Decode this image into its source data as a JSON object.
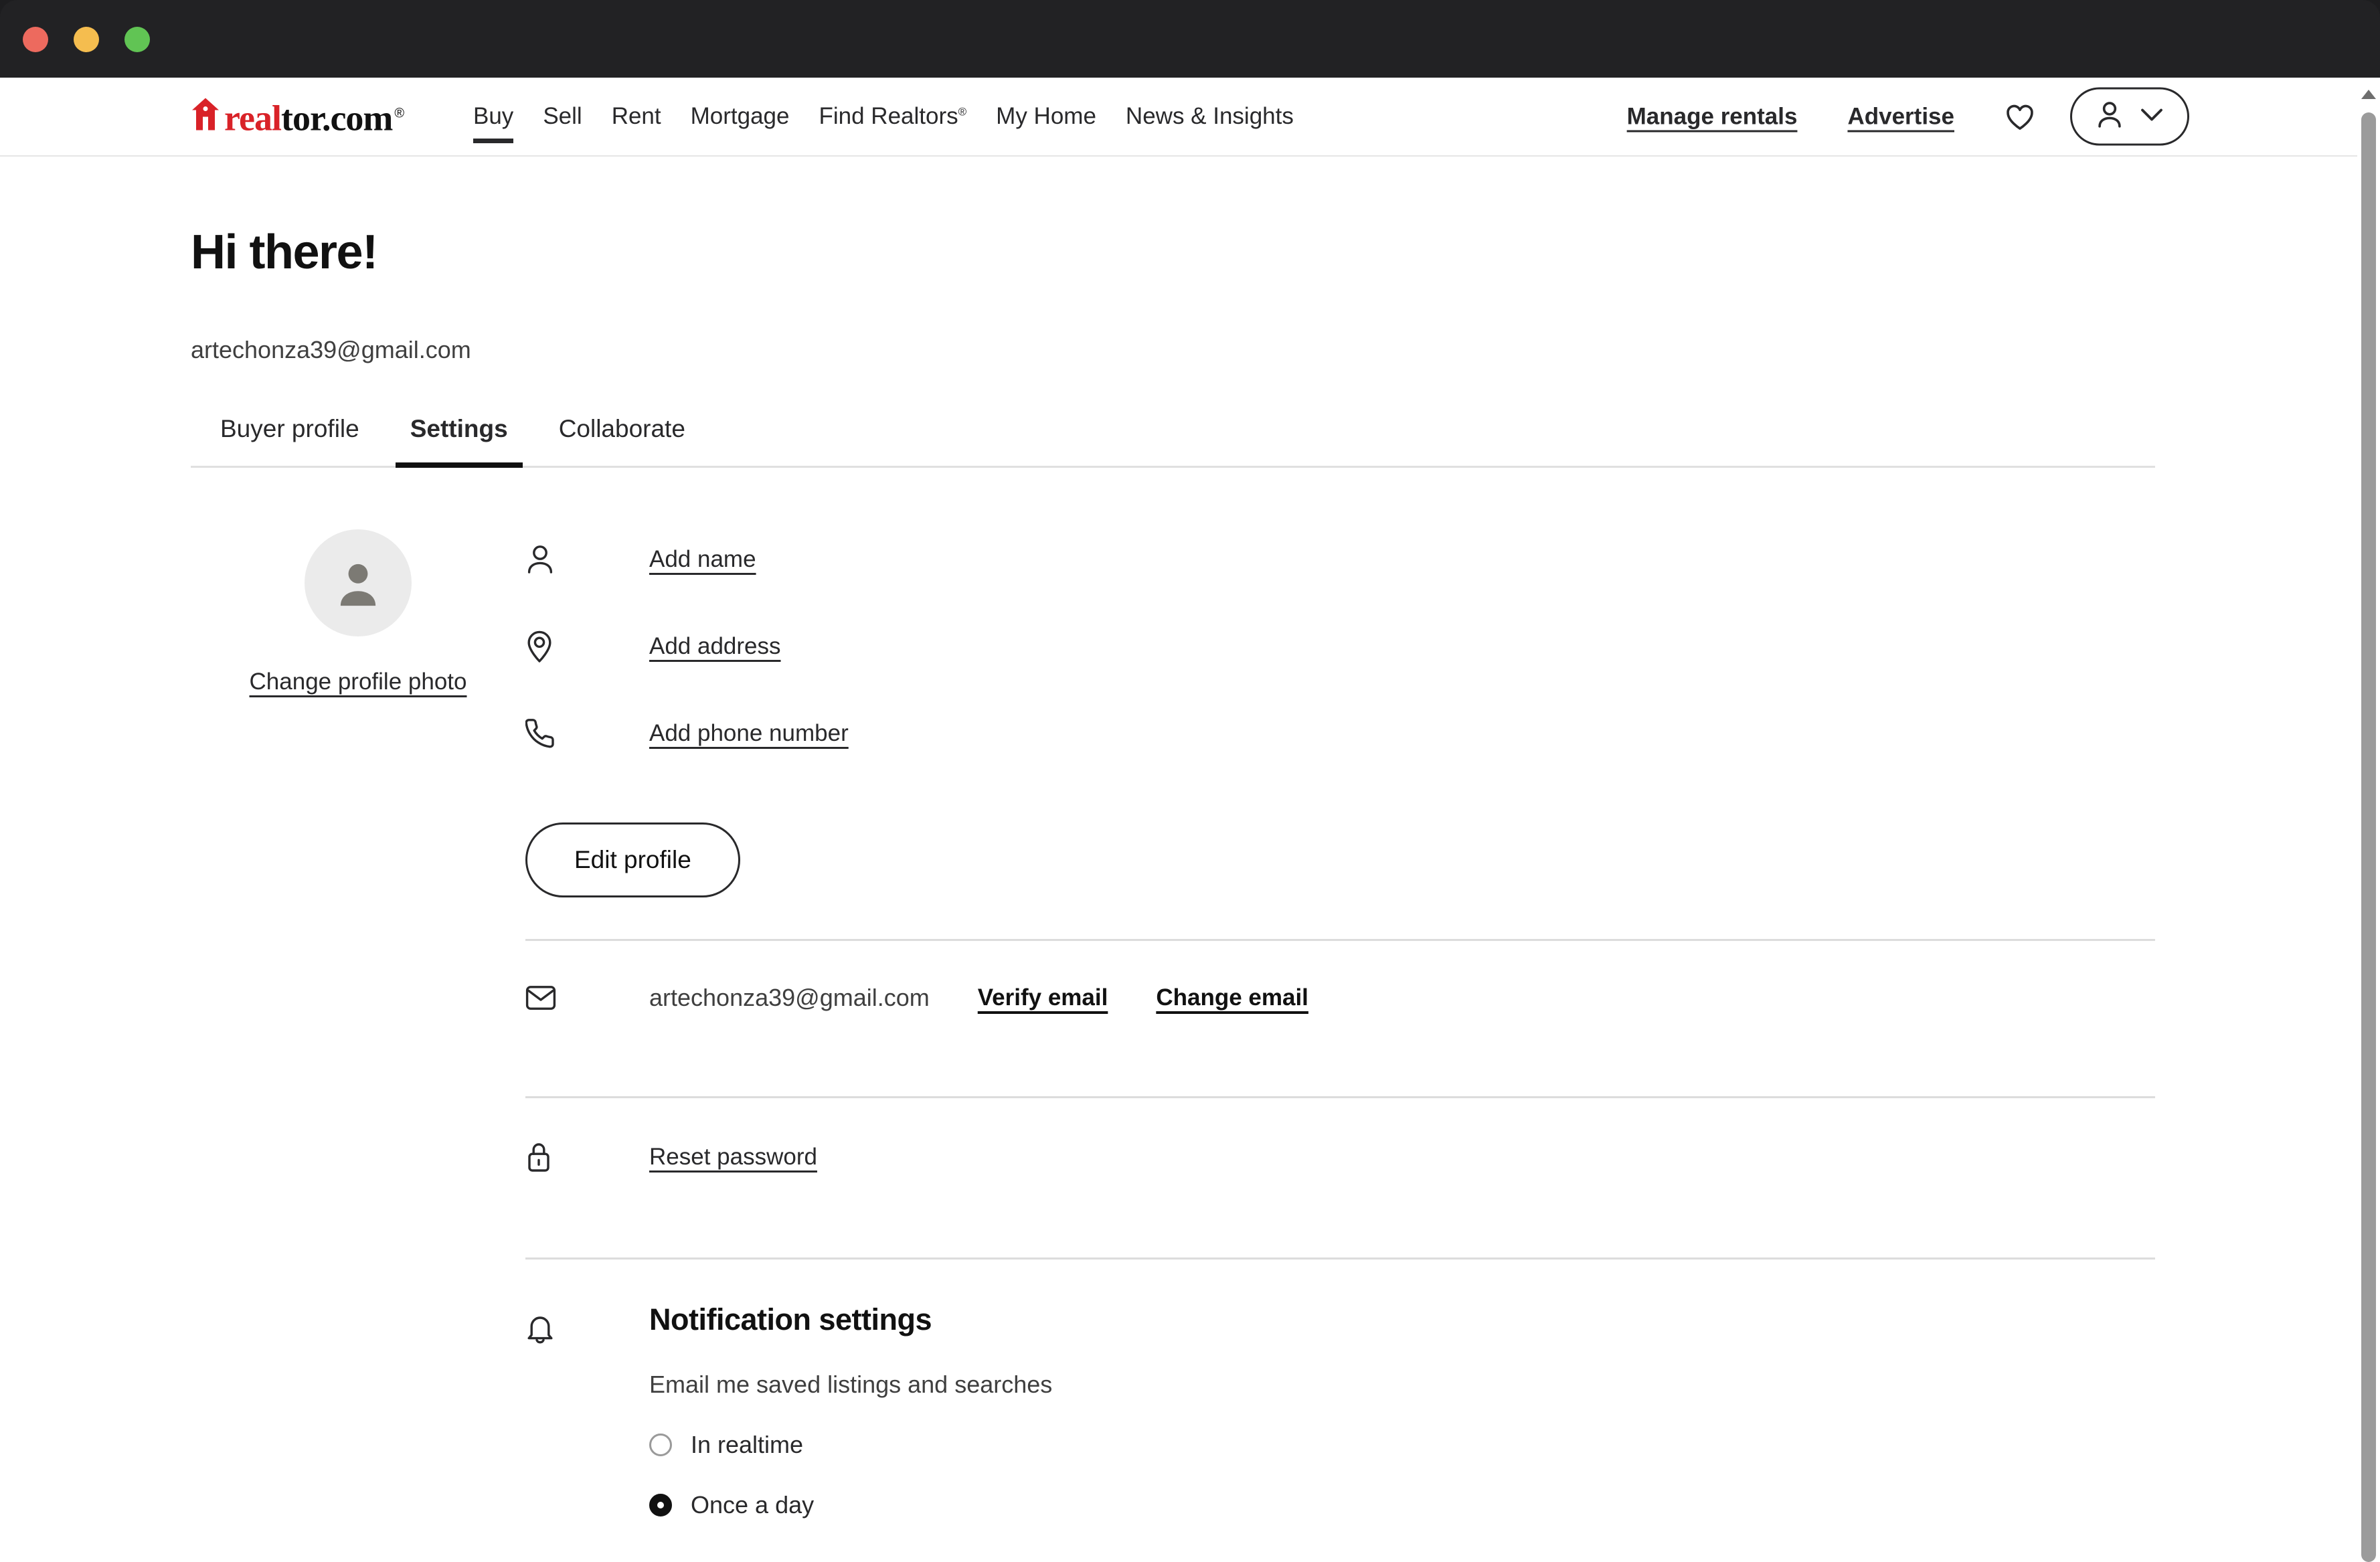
{
  "window": {
    "traffic_lights": [
      "close",
      "minimize",
      "maximize"
    ],
    "colors": {
      "close": "#ed6a5e",
      "minimize": "#f5bd4f",
      "maximize": "#61c454",
      "chrome_bg": "#222224"
    }
  },
  "header": {
    "logo": {
      "brand_red": "real",
      "brand_black": "tor.com",
      "registered_mark": "®",
      "accent_color": "#d92228"
    },
    "nav": [
      {
        "label": "Buy",
        "active": true
      },
      {
        "label": "Sell",
        "active": false
      },
      {
        "label": "Rent",
        "active": false
      },
      {
        "label": "Mortgage",
        "active": false
      },
      {
        "label": "Find Realtors",
        "superscript": "®",
        "active": false
      },
      {
        "label": "My Home",
        "active": false
      },
      {
        "label": "News & Insights",
        "active": false
      }
    ],
    "links": [
      {
        "label": "Manage rentals"
      },
      {
        "label": "Advertise"
      }
    ],
    "icons": {
      "favorites": "heart-icon",
      "account": "person-icon",
      "account_chevron": "chevron-down-icon"
    }
  },
  "page": {
    "greeting": "Hi there!",
    "account_email": "artechonza39@gmail.com"
  },
  "tabs": [
    {
      "label": "Buyer profile",
      "active": false
    },
    {
      "label": "Settings",
      "active": true
    },
    {
      "label": "Collaborate",
      "active": false
    }
  ],
  "profile": {
    "avatar_alt": "default-avatar",
    "change_photo_label": "Change profile photo",
    "details": [
      {
        "icon": "person-icon",
        "label": "Add name"
      },
      {
        "icon": "location-pin-icon",
        "label": "Add address"
      },
      {
        "icon": "phone-icon",
        "label": "Add phone number"
      }
    ],
    "edit_button_label": "Edit profile"
  },
  "email_section": {
    "icon": "envelope-icon",
    "email": "artechonza39@gmail.com",
    "verify_label": "Verify email",
    "change_label": "Change email"
  },
  "password_section": {
    "icon": "lock-icon",
    "reset_label": "Reset password"
  },
  "notifications": {
    "icon": "bell-icon",
    "title": "Notification settings",
    "subtitle": "Email me saved listings and searches",
    "options": [
      {
        "label": "In realtime",
        "selected": false
      },
      {
        "label": "Once a day",
        "selected": true
      }
    ]
  },
  "scrollbar": {
    "position": "top"
  }
}
